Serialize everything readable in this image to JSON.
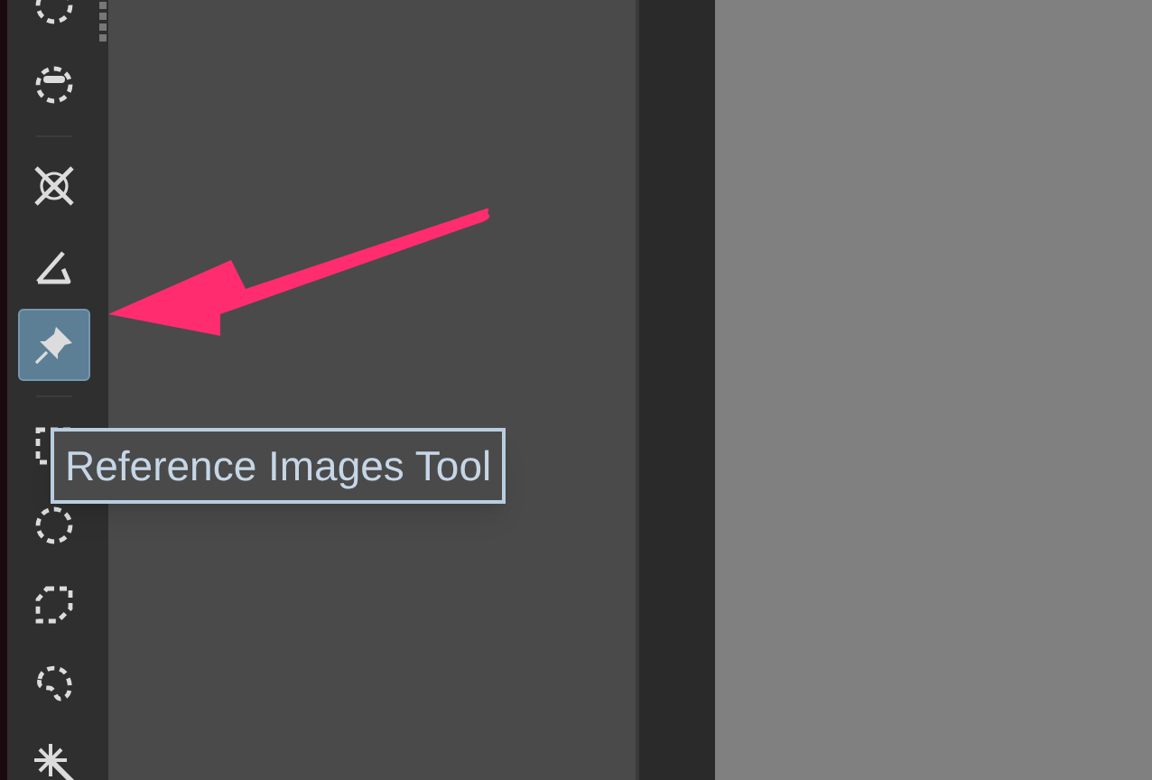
{
  "toolbox": {
    "items": [
      {
        "kind": "tool",
        "selected": false
      },
      {
        "kind": "tool",
        "selected": false
      },
      {
        "kind": "separator"
      },
      {
        "kind": "tool",
        "selected": false
      },
      {
        "kind": "tool",
        "selected": false
      },
      {
        "kind": "tool",
        "selected": true
      },
      {
        "kind": "separator"
      },
      {
        "kind": "tool",
        "selected": false
      },
      {
        "kind": "tool",
        "selected": false
      },
      {
        "kind": "tool",
        "selected": false
      },
      {
        "kind": "tool",
        "selected": false
      },
      {
        "kind": "tool",
        "selected": false
      }
    ]
  },
  "tooltip": {
    "text": "Reference Images Tool"
  }
}
